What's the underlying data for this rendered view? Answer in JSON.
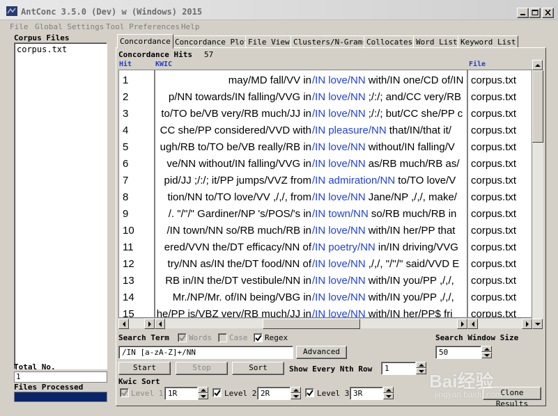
{
  "window": {
    "title": "AntConc 3.5.0 (Dev) w (Windows) 2015"
  },
  "menu": [
    "File",
    "Global Settings",
    "Tool Preferences",
    "Help"
  ],
  "left": {
    "corpus_files_label": "Corpus Files",
    "files": [
      "corpus.txt"
    ],
    "total_label": "Total No.",
    "total_value": "1",
    "processed_label": "Files Processed"
  },
  "tabs": [
    "Concordance",
    "Concordance Plot",
    "File View",
    "Clusters/N-Grams",
    "Collocates",
    "Word List",
    "Keyword List"
  ],
  "concordance": {
    "hits_label": "Concordance Hits",
    "hits_count": "57",
    "col_hit": "Hit",
    "col_kwic": "KWIC",
    "col_file": "File",
    "rows": [
      {
        "hit": "1",
        "left": "may/MD fall/VV in",
        "key": "/IN love/NN",
        "right": "with/IN one/CD of/IN",
        "file": "corpus.txt"
      },
      {
        "hit": "2",
        "left": "p/NN towards/IN falling/VVG in",
        "key": "/IN love/NN",
        "right": ";/:/; and/CC very/RB",
        "file": "corpus.txt"
      },
      {
        "hit": "3",
        "left": "to/TO be/VB very/RB much/JJ in",
        "key": "/IN love/NN",
        "right": ";/:/; but/CC she/PP c",
        "file": "corpus.txt"
      },
      {
        "hit": "4",
        "left": "CC she/PP considered/VVD with",
        "key": "/IN pleasure/NN",
        "right": "that/IN/that it/",
        "file": "corpus.txt"
      },
      {
        "hit": "5",
        "left": "ugh/RB to/TO be/VB really/RB in",
        "key": "/IN love/NN",
        "right": "without/IN falling/V",
        "file": "corpus.txt"
      },
      {
        "hit": "6",
        "left": "ve/NN without/IN falling/VVG in",
        "key": "/IN love/NN",
        "right": "as/RB much/RB as/",
        "file": "corpus.txt"
      },
      {
        "hit": "7",
        "left": "pid/JJ ;/:/; it/PP jumps/VVZ from",
        "key": "/IN admiration/NN",
        "right": "to/TO love/V",
        "file": "corpus.txt"
      },
      {
        "hit": "8",
        "left": "tion/NN to/TO love/VV ,/,/, from",
        "key": "/IN love/NN",
        "right": "Jane/NP ,/,/, make/",
        "file": "corpus.txt"
      },
      {
        "hit": "9",
        "left": "/. \"/''/\" Gardiner/NP 's/POS/'s in",
        "key": "/IN town/NN",
        "right": "so/RB much/RB in",
        "file": "corpus.txt"
      },
      {
        "hit": "10",
        "left": "/IN town/NN so/RB much/RB in",
        "key": "/IN love/NN",
        "right": "with/IN her/PP that",
        "file": "corpus.txt"
      },
      {
        "hit": "11",
        "left": "ered/VVN the/DT efficacy/NN of",
        "key": "/IN poetry/NN",
        "right": "in/IN driving/VVG",
        "file": "corpus.txt"
      },
      {
        "hit": "12",
        "left": "try/NN as/IN the/DT food/NN of",
        "key": "/IN love/NN",
        "right": ",/,/, \"/''/\" said/VVD E",
        "file": "corpus.txt"
      },
      {
        "hit": "13",
        "left": "RB in/IN the/DT vestibule/NN in",
        "key": "/IN love/NN",
        "right": "with/IN you/PP ,/,/,",
        "file": "corpus.txt"
      },
      {
        "hit": "14",
        "left": "Mr./NP/Mr. of/IN being/VBG in",
        "key": "/IN love/NN",
        "right": "with/IN you/PP ,/,/,",
        "file": "corpus.txt"
      },
      {
        "hit": "15",
        "left": "he/PP is/VBZ very/RB much/JJ in",
        "key": "/IN love/NN",
        "right": "with/IN her/PP$ fri",
        "file": "corpus.txt"
      }
    ]
  },
  "search": {
    "label": "Search Term",
    "words_label": "Words",
    "case_label": "Case",
    "regex_label": "Regex",
    "value": "/IN [a-zA-Z]+/NN",
    "advanced_label": "Advanced",
    "window_label": "Search Window Size",
    "window_value": "50"
  },
  "actions": {
    "start": "Start",
    "stop": "Stop",
    "sort": "Sort",
    "nth_row_label": "Show Every Nth Row",
    "nth_row_value": "1"
  },
  "kwic_sort": {
    "label": "Kwic Sort",
    "level1_label": "Level 1",
    "level1_value": "1R",
    "level2_label": "Level 2",
    "level2_value": "2R",
    "level3_label": "Level 3",
    "level3_value": "3R",
    "clone_label": "Clone Results"
  },
  "watermark": {
    "logo": "Bai经验",
    "sub": "jingyan.baidu.com"
  }
}
